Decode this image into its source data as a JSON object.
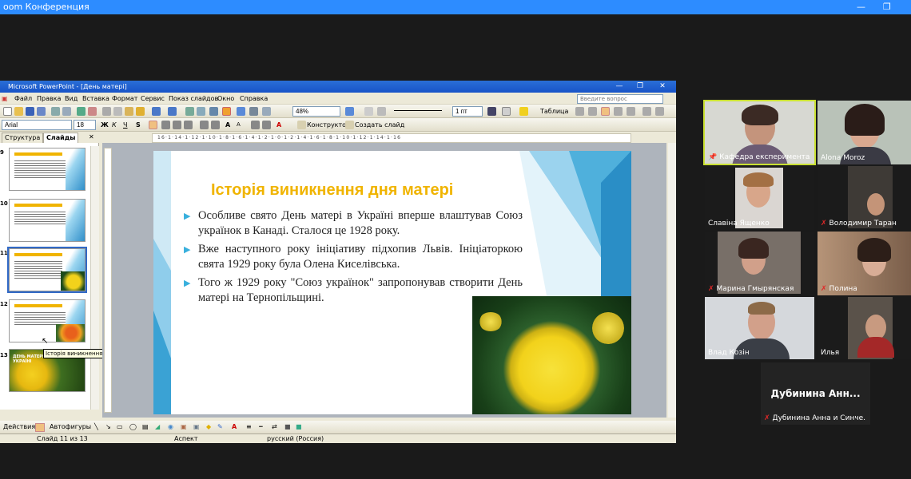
{
  "zoom": {
    "title": "oom Конференция"
  },
  "ppt": {
    "window_title": "Microsoft PowerPoint - [День матері]",
    "menu": [
      "Файл",
      "Правка",
      "Вид",
      "Вставка",
      "Формат",
      "Сервис",
      "Показ слайдов",
      "Окно",
      "Справка"
    ],
    "help_placeholder": "Введите вопрос",
    "zoom_value": "48%",
    "line_width": "1 пт",
    "table_label": "Таблица",
    "font_name": "Arial",
    "font_size": "18",
    "designer_label": "Конструктор",
    "new_slide_label": "Создать слайд",
    "tab_structure": "Структура",
    "tab_slides": "Слайды",
    "ruler_h": "16·1·14·1·12·1·10·1·8·1·6·1·4·1·2·1·0·1·2·1·4·1·6·1·8·1·10·1·12·1·14·1·16",
    "thumbs": [
      {
        "num": "9",
        "sel": false
      },
      {
        "num": "10",
        "sel": false
      },
      {
        "num": "11",
        "sel": true
      },
      {
        "num": "12",
        "sel": false
      },
      {
        "num": "13",
        "sel": false
      }
    ],
    "thumb13_text": "ДЕНЬ МАТЕРІ В УКРАЇНІ",
    "tooltip": "Історія виникнення дня матері",
    "slide": {
      "title": "Історія виникнення дня матері",
      "bullets": [
        "Особливе свято День матері в Україні вперше влаштував Союз українок в Канаді. Сталося це 1928 року.",
        "Вже наступного року ініціативу підхопив Львів. Ініціаторкою свята 1929 року була Олена Киселівська.",
        "Того ж 1929 року \"Союз українок\" запропонував створити День матері на Тернопільщині."
      ]
    },
    "draw_actions": "Действия",
    "draw_autoshapes": "Автофигуры",
    "status": {
      "slide": "Слайд 11 из 13",
      "design": "Аспект",
      "lang": "русский (Россия)"
    }
  },
  "participants": [
    {
      "name": "Кафедра експериментал...",
      "muted": false,
      "pinned": true,
      "active": true
    },
    {
      "name": "Alona Moroz",
      "muted": false,
      "pinned": false,
      "active": false
    },
    {
      "name": "Славіна Ященко",
      "muted": false,
      "pinned": false,
      "active": false
    },
    {
      "name": "Володимир Таран",
      "muted": true,
      "pinned": false,
      "active": false
    },
    {
      "name": "Марина Гмырянская",
      "muted": true,
      "pinned": false,
      "active": false
    },
    {
      "name": "Полина",
      "muted": true,
      "pinned": false,
      "active": false
    },
    {
      "name": "Влад Козін",
      "muted": false,
      "pinned": false,
      "active": false
    },
    {
      "name": "Илья",
      "muted": false,
      "pinned": false,
      "active": false
    }
  ],
  "no_video_tile": {
    "big_name": "Дубинина Анн...",
    "name": "Дубинина Анна и Синче..."
  }
}
